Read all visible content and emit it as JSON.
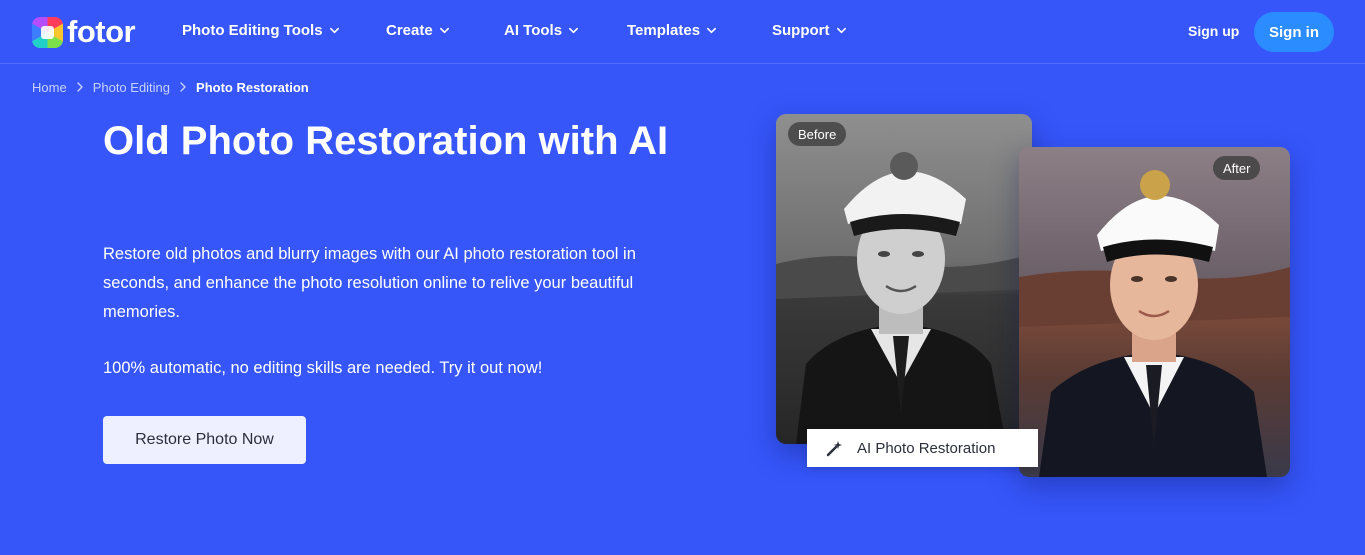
{
  "header": {
    "logo_text": "fotor",
    "nav": [
      {
        "label": "Photo Editing Tools"
      },
      {
        "label": "Create"
      },
      {
        "label": "AI Tools"
      },
      {
        "label": "Templates"
      },
      {
        "label": "Support"
      }
    ],
    "signup_label": "Sign up",
    "signin_label": "Sign in"
  },
  "breadcrumb": {
    "items": [
      "Home",
      "Photo Editing",
      "Photo Restoration"
    ]
  },
  "hero": {
    "title": "Old Photo Restoration with AI",
    "description": "Restore old photos and blurry images with our AI photo restoration tool in seconds, and enhance the photo resolution online to relive your beautiful memories.",
    "note": "100% automatic, no editing skills are needed. Try it out now!",
    "cta_label": "Restore Photo Now"
  },
  "showcase": {
    "before_label": "Before",
    "after_label": "After",
    "feature_label": "AI Photo Restoration"
  },
  "colors": {
    "background": "#3656fa",
    "signin_button": "#2b8cff",
    "cta_button": "#eef0ff"
  },
  "icons": {
    "logo": "fotor-logo-icon",
    "nav_chevron": "chevron-down-icon",
    "breadcrumb_separator": "chevron-right-icon",
    "feature": "magic-wand-icon"
  }
}
